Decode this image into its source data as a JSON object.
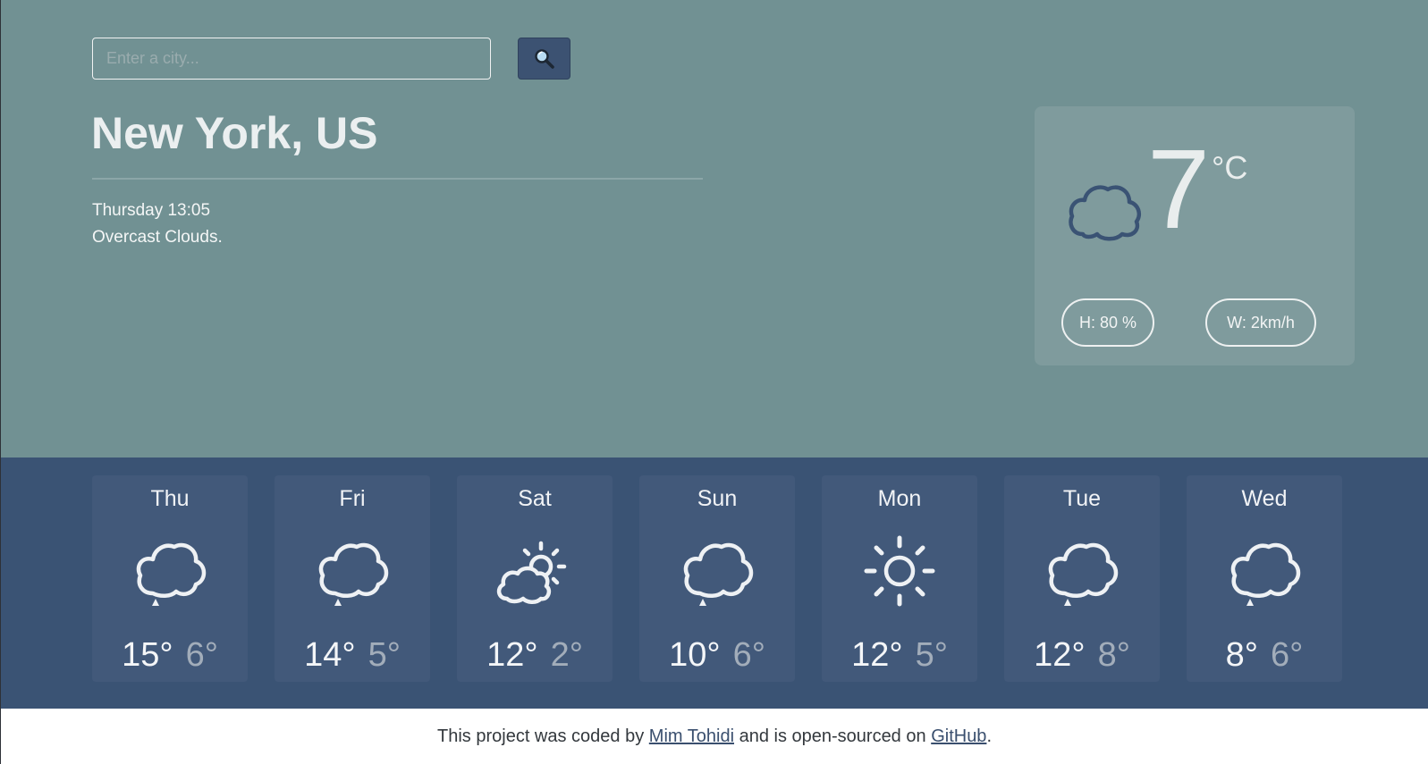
{
  "search": {
    "placeholder": "Enter a city...",
    "button_icon": "magnifier-icon"
  },
  "location": {
    "city": "New York, US",
    "datetime": "Thursday 13:05",
    "description": "Overcast Clouds."
  },
  "current": {
    "icon": "cloud-icon",
    "temperature": "7",
    "unit": "°C",
    "humidity": "H: 80 %",
    "wind": "W: 2km/h"
  },
  "forecast": [
    {
      "day": "Thu",
      "icon": "cloud-icon",
      "max": "15°",
      "min": "6°"
    },
    {
      "day": "Fri",
      "icon": "cloud-icon",
      "max": "14°",
      "min": "5°"
    },
    {
      "day": "Sat",
      "icon": "partly-cloudy-icon",
      "max": "12°",
      "min": "2°"
    },
    {
      "day": "Sun",
      "icon": "cloud-icon",
      "max": "10°",
      "min": "6°"
    },
    {
      "day": "Mon",
      "icon": "sun-icon",
      "max": "12°",
      "min": "5°"
    },
    {
      "day": "Tue",
      "icon": "cloud-icon",
      "max": "12°",
      "min": "8°"
    },
    {
      "day": "Wed",
      "icon": "cloud-icon",
      "max": "8°",
      "min": "6°"
    }
  ],
  "footer": {
    "text1": "This project was coded by ",
    "author_link": "Mim Tohidi",
    "text2": " and is open-sourced on ",
    "repo_link": "GitHub",
    "text3": "."
  },
  "colors": {
    "hero_bg": "#719193",
    "forecast_bg": "#3a5374",
    "accent": "#3c5272"
  }
}
